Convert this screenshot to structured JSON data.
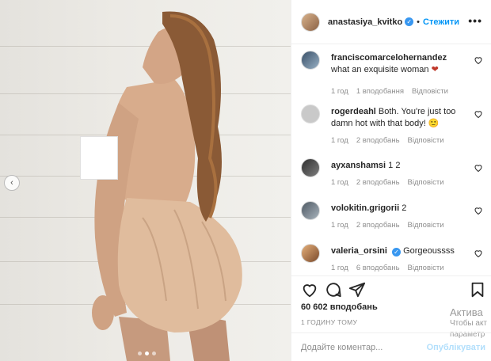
{
  "post": {
    "author": "anastasiya_kvitko",
    "separator": "•",
    "follow_label": "Стежити",
    "more_label": "•••"
  },
  "comments": [
    {
      "user": "franciscomarcelohernandez",
      "text": "what an exquisite woman",
      "emoji": "❤",
      "time": "1 год",
      "likes": "1 вподобання",
      "reply": "Відповісти"
    },
    {
      "user": "rogerdeahl",
      "text": "Both. You're just too damn hot with that body!",
      "emoji": "🙂",
      "time": "1 год",
      "likes": "2 вподобань",
      "reply": "Відповісти"
    },
    {
      "user": "ayxanshamsi",
      "text": "1 2",
      "emoji": "",
      "time": "1 год",
      "likes": "2 вподобань",
      "reply": "Відповісти"
    },
    {
      "user": "volokitin.grigorii",
      "text": "2",
      "emoji": "",
      "time": "1 год",
      "likes": "2 вподобань",
      "reply": "Відповісти"
    },
    {
      "user": "valeria_orsini",
      "text": "Gorgeoussss",
      "emoji": "",
      "time": "1 год",
      "likes": "6 вподобань",
      "reply": "Відповісти"
    }
  ],
  "stats": {
    "likes": "60 602 вподобань",
    "time": "1 ГОДИНУ ТОМУ"
  },
  "add_comment": {
    "placeholder": "Додайте коментар...",
    "publish_label": "Опублікувати"
  },
  "watermark": {
    "line1": "Актива",
    "line2": "Чтобы акт",
    "line3": "параметр"
  },
  "carousel": {
    "prev_label": "‹",
    "slides": 3,
    "active_slide": 2
  }
}
